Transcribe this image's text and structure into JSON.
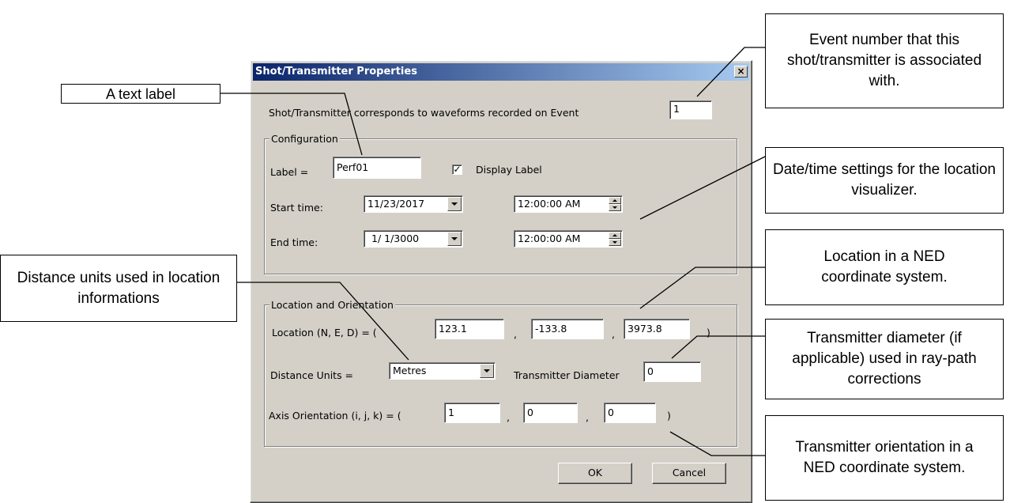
{
  "dialog": {
    "title": "Shot/Transmitter Properties",
    "close_symbol": "×",
    "event_label": "Shot/Transmitter corresponds to waveforms recorded on Event",
    "event_value": "1",
    "configuration": {
      "group_title": "Configuration",
      "label_caption": "Label =",
      "label_value": "Perf01",
      "display_label_checked": true,
      "display_label_text": "Display Label",
      "check_mark": "✓",
      "start_time_caption": "Start time:",
      "start_date": "11/23/2017",
      "start_clock": "12:00:00 AM",
      "end_time_caption": "End time:",
      "end_date": "1/ 1/3000",
      "end_clock": "12:00:00 AM"
    },
    "location": {
      "group_title": "Location and Orientation",
      "location_caption": "Location (N, E, D) = (",
      "n": "123.1",
      "e": "-133.8",
      "d": "3973.8",
      "comma": ",",
      "close_paren": ")",
      "units_caption": "Distance Units =",
      "units_value": "Metres",
      "diameter_caption": "Transmitter Diameter",
      "diameter_value": "0",
      "axis_caption": "Axis Orientation (i, j, k) = (",
      "i": "1",
      "j": "0",
      "k": "0"
    },
    "ok_label": "OK",
    "cancel_label": "Cancel"
  },
  "callouts": {
    "text_label": "A text label",
    "event_number": "Event number that this shot/transmitter is associated with.",
    "datetime": "Date/time settings for the location visualizer.",
    "distance_units": "Distance units used in location informations",
    "location_ned": "Location in a NED coordinate system.",
    "diameter": "Transmitter diameter (if applicable) used in ray-path corrections",
    "orientation": "Transmitter orientation in a NED coordinate system."
  }
}
